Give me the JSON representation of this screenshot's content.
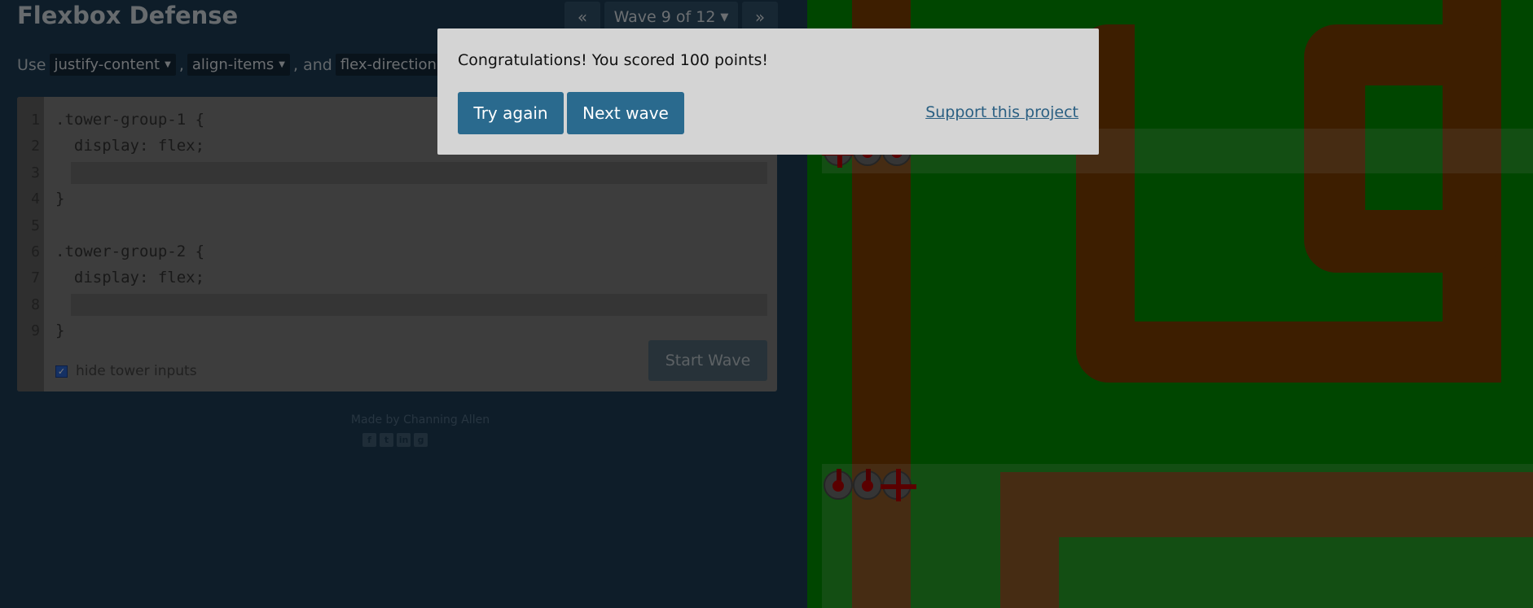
{
  "app": {
    "title": "Flexbox Defense",
    "wave_nav": {
      "prev_icon": "double-chevron-left",
      "label": "Wave 9 of 12",
      "next_icon": "double-chevron-right"
    }
  },
  "instructions": {
    "use": "Use",
    "chips": [
      "justify-content",
      "align-items",
      "flex-direction"
    ],
    "sep_comma": ",",
    "sep_and": ", and"
  },
  "editor": {
    "line_numbers": [
      "1",
      "2",
      "3",
      "4",
      "5",
      "6",
      "7",
      "8",
      "9"
    ],
    "lines": [
      ".tower-group-1 {",
      "  display: flex;",
      "",
      "}",
      "",
      ".tower-group-2 {",
      "  display: flex;",
      "",
      "}"
    ],
    "start_button": "Start Wave",
    "hide_inputs_label": "hide tower inputs",
    "hide_inputs_checked": true
  },
  "footer": {
    "credit": "Made by Channing Allen",
    "social_icons": [
      "facebook-icon",
      "twitter-icon",
      "linkedin-icon",
      "github-icon"
    ]
  },
  "modal": {
    "message": "Congratulations! You scored 100 points!",
    "try_again": "Try again",
    "next_wave": "Next wave",
    "support": "Support this project"
  },
  "colors": {
    "board_grass": "#008c00",
    "board_road": "#7a3d00",
    "panel_bg": "#1d3b52",
    "button_accent": "#2a6a8e"
  }
}
